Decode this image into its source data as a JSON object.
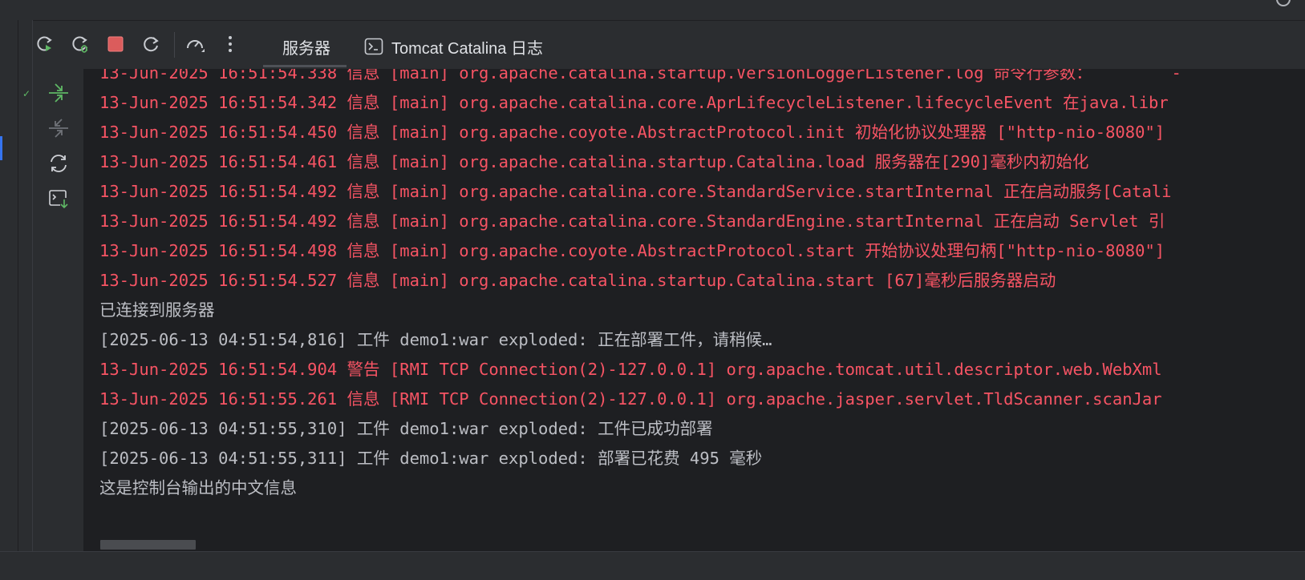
{
  "toolbar": {
    "buttons": [
      {
        "name": "rerun-icon",
        "color": "#5fb865"
      },
      {
        "name": "debug-icon",
        "color": "#5fb865"
      },
      {
        "name": "stop-icon",
        "color": "#db5c5c"
      },
      {
        "name": "refresh-icon",
        "color": "#b0b3b8"
      },
      {
        "name": "speedometer-icon",
        "color": "#b0b3b8"
      },
      {
        "name": "more-vertical-icon",
        "color": "#b0b3b8"
      }
    ],
    "tabs": [
      {
        "label": "服务器",
        "active": true
      },
      {
        "label": "Tomcat Catalina 日志",
        "icon": "terminal-icon",
        "active": false
      }
    ]
  },
  "side_actions": [
    {
      "name": "scroll-to-end-icon",
      "color": "#5fb865"
    },
    {
      "name": "soft-wrap-icon",
      "color": "#6f7278"
    },
    {
      "name": "sync-icon",
      "color": "#cfd1d6"
    },
    {
      "name": "export-console-icon",
      "color": "#cfd1d6"
    }
  ],
  "console": {
    "lines": [
      {
        "text": "13-Jun-2025 16:51:54.338 信息 [main] org.apache.catalina.startup.VersionLoggerListener.log 命令行参数：        -",
        "kind": "red"
      },
      {
        "text": "13-Jun-2025 16:51:54.342 信息 [main] org.apache.catalina.core.AprLifecycleListener.lifecycleEvent 在java.libr",
        "kind": "red"
      },
      {
        "text": "13-Jun-2025 16:51:54.450 信息 [main] org.apache.coyote.AbstractProtocol.init 初始化协议处理器 [\"http-nio-8080\"]",
        "kind": "red"
      },
      {
        "text": "13-Jun-2025 16:51:54.461 信息 [main] org.apache.catalina.startup.Catalina.load 服务器在[290]毫秒内初始化",
        "kind": "red"
      },
      {
        "text": "13-Jun-2025 16:51:54.492 信息 [main] org.apache.catalina.core.StandardService.startInternal 正在启动服务[Catali",
        "kind": "red"
      },
      {
        "text": "13-Jun-2025 16:51:54.492 信息 [main] org.apache.catalina.core.StandardEngine.startInternal 正在启动 Servlet 引",
        "kind": "red"
      },
      {
        "text": "13-Jun-2025 16:51:54.498 信息 [main] org.apache.coyote.AbstractProtocol.start 开始协议处理句柄[\"http-nio-8080\"]",
        "kind": "red"
      },
      {
        "text": "13-Jun-2025 16:51:54.527 信息 [main] org.apache.catalina.startup.Catalina.start [67]毫秒后服务器启动",
        "kind": "red"
      },
      {
        "text": "已连接到服务器",
        "kind": "gray"
      },
      {
        "text": "[2025-06-13 04:51:54,816] 工件 demo1:war exploded: 正在部署工件，请稍候…",
        "kind": "gray"
      },
      {
        "text": "13-Jun-2025 16:51:54.904 警告 [RMI TCP Connection(2)-127.0.0.1] org.apache.tomcat.util.descriptor.web.WebXml",
        "kind": "red"
      },
      {
        "text": "13-Jun-2025 16:51:55.261 信息 [RMI TCP Connection(2)-127.0.0.1] org.apache.jasper.servlet.TldScanner.scanJar",
        "kind": "red"
      },
      {
        "text": "[2025-06-13 04:51:55,310] 工件 demo1:war exploded: 工件已成功部署",
        "kind": "gray"
      },
      {
        "text": "[2025-06-13 04:51:55,311] 工件 demo1:war exploded: 部署已花费 495 毫秒",
        "kind": "gray"
      },
      {
        "text": "这是控制台输出的中文信息",
        "kind": "gray"
      }
    ]
  },
  "colors": {
    "error_text": "#f75464",
    "normal_text": "#bcbec4",
    "background": "#1e1f22",
    "panel": "#2b2d30"
  }
}
